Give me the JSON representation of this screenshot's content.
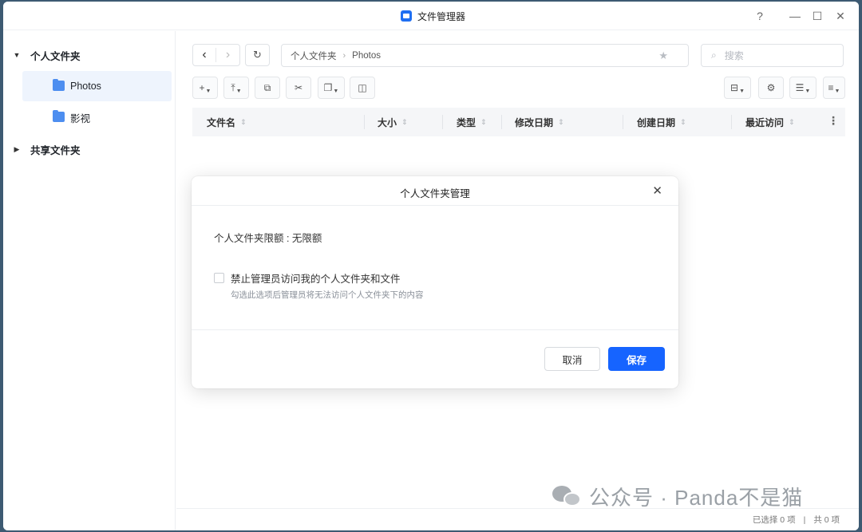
{
  "window": {
    "title": "文件管理器",
    "help": "?",
    "minimize": "—",
    "maximize": "☐",
    "close": "✕"
  },
  "sidebar": {
    "personal_group": "个人文件夹",
    "personal_items": [
      {
        "label": "Photos"
      },
      {
        "label": "影视"
      }
    ],
    "shared_group": "共享文件夹"
  },
  "toolbar": {
    "back": "‹",
    "forward": "›",
    "refresh": "↻",
    "breadcrumb": [
      "个人文件夹",
      "Photos"
    ],
    "search_placeholder": "搜索"
  },
  "table": {
    "columns": [
      "文件名",
      "大小",
      "类型",
      "修改日期",
      "创建日期",
      "最近访问"
    ]
  },
  "status": {
    "selected": "已选择 0 项",
    "total": "共 0 项"
  },
  "watermark": "公众号 · Panda不是猫",
  "dialog": {
    "title": "个人文件夹管理",
    "quota_text": "个人文件夹限额 : 无限额",
    "checkbox_label": "禁止管理员访问我的个人文件夹和文件",
    "checkbox_hint": "勾选此选项后管理员将无法访问个人文件夹下的内容",
    "cancel": "取消",
    "save": "保存"
  },
  "colors": {
    "accent": "#1664ff",
    "folder": "#4d8ef0",
    "sidebar_active": "#eef4fd"
  }
}
